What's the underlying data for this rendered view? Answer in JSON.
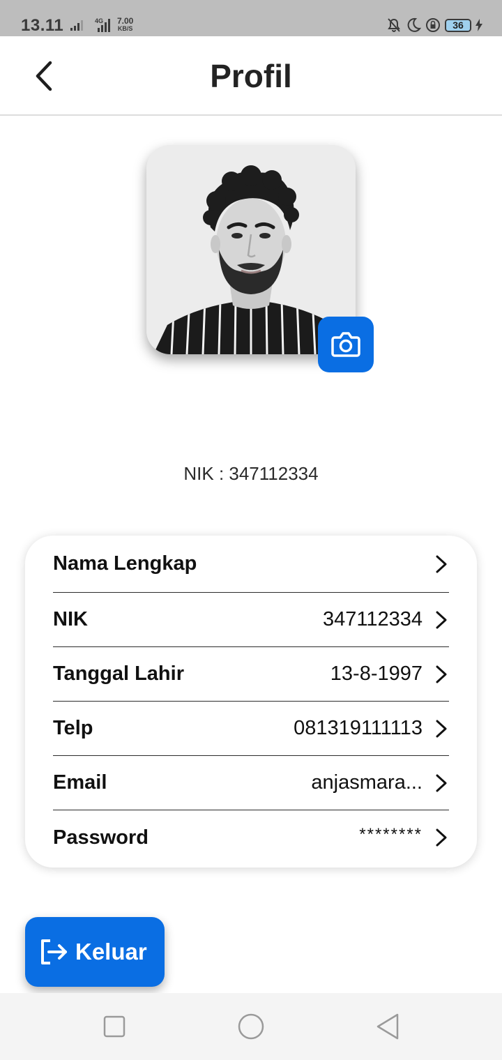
{
  "status_bar": {
    "time": "13.11",
    "network_type": "4G",
    "speed_value": "7.00",
    "speed_unit": "KB/S",
    "battery_level": "36",
    "icons": [
      "signal-icon",
      "signal-4g-icon",
      "mute-icon",
      "moon-icon",
      "lock-rotation-icon",
      "battery-icon",
      "charging-icon"
    ]
  },
  "header": {
    "title": "Profil",
    "back_icon": "chevron-left-icon"
  },
  "profile": {
    "avatar_icon": "profile-photo",
    "camera_icon": "camera-icon",
    "nik_caption": "NIK : 347112334"
  },
  "card": {
    "rows": [
      {
        "label": "Nama Lengkap",
        "value": ""
      },
      {
        "label": "NIK",
        "value": "347112334"
      },
      {
        "label": "Tanggal Lahir",
        "value": "13-8-1997"
      },
      {
        "label": "Telp",
        "value": "081319111113"
      },
      {
        "label": "Email",
        "value": "anjasmara..."
      },
      {
        "label": "Password",
        "value": "********"
      }
    ]
  },
  "logout": {
    "label": "Keluar",
    "icon": "logout-icon"
  },
  "nav_bar": {
    "icons": [
      "recent-apps-icon",
      "home-icon",
      "back-icon"
    ]
  },
  "colors": {
    "primary": "#0a6ee3",
    "status_bar_bg": "#bdbdbd",
    "nav_bar_bg": "#f4f4f4",
    "battery_fill": "#9fd0ee"
  }
}
